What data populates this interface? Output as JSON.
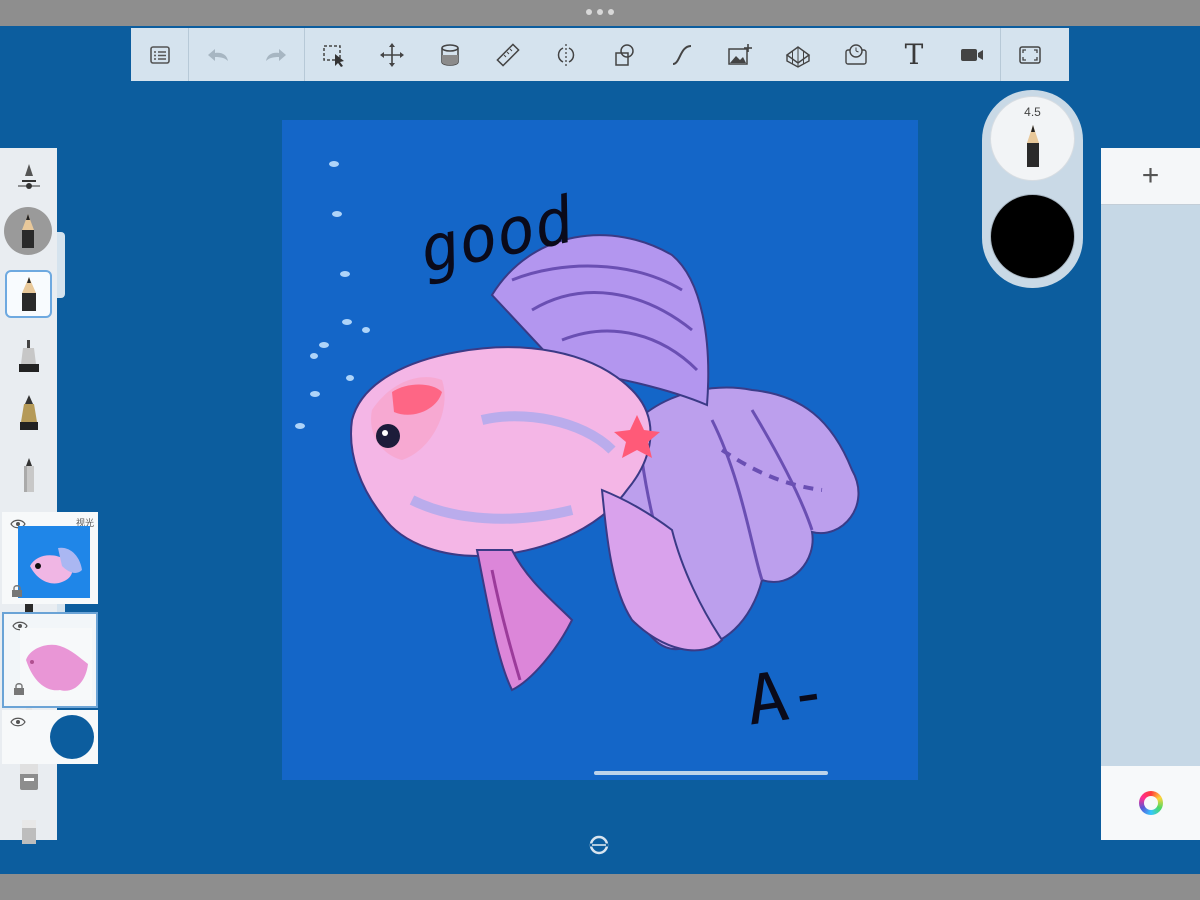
{
  "app": {
    "colors": {
      "workspace": "#0c5d9e",
      "canvas_background": "#1466c8",
      "toolbar_bg": "#d5e3ee",
      "current_color": "#000000",
      "fish_pink": "#ee9ad8",
      "fish_violet": "#9a8de6",
      "fish_red": "#ff5a78"
    }
  },
  "toolbar": {
    "tools": [
      {
        "icon": "list-icon",
        "label": ""
      },
      {
        "icon": "undo-icon",
        "label": ""
      },
      {
        "icon": "redo-icon",
        "label": ""
      },
      {
        "icon": "selection-icon",
        "label": ""
      },
      {
        "icon": "transform-icon",
        "label": ""
      },
      {
        "icon": "fill-bucket-icon",
        "label": ""
      },
      {
        "icon": "ruler-icon",
        "label": ""
      },
      {
        "icon": "symmetry-icon",
        "label": ""
      },
      {
        "icon": "shapes-icon",
        "label": ""
      },
      {
        "icon": "curve-icon",
        "label": ""
      },
      {
        "icon": "image-import-icon",
        "label": ""
      },
      {
        "icon": "perspective-grid-icon",
        "label": ""
      },
      {
        "icon": "timelapse-icon",
        "label": ""
      },
      {
        "icon": "text-icon",
        "label": "T"
      },
      {
        "icon": "record-icon",
        "label": ""
      },
      {
        "icon": "fullscreen-icon",
        "label": ""
      }
    ]
  },
  "brush_puck": {
    "size_label": "4.5"
  },
  "canvas": {
    "handwriting_top": "good",
    "handwriting_grade": "A-"
  },
  "layers": {
    "add_label": "+",
    "items": [
      {
        "name": "fish-reference-layer",
        "blend_label": "视光",
        "visible": true,
        "locked": true
      },
      {
        "name": "pink-paint-layer",
        "blend_label": "",
        "visible": true,
        "locked": true,
        "selected": true
      },
      {
        "name": "background-layer",
        "blend_label": "",
        "visible": true,
        "color": "#0c5d9e"
      }
    ]
  }
}
